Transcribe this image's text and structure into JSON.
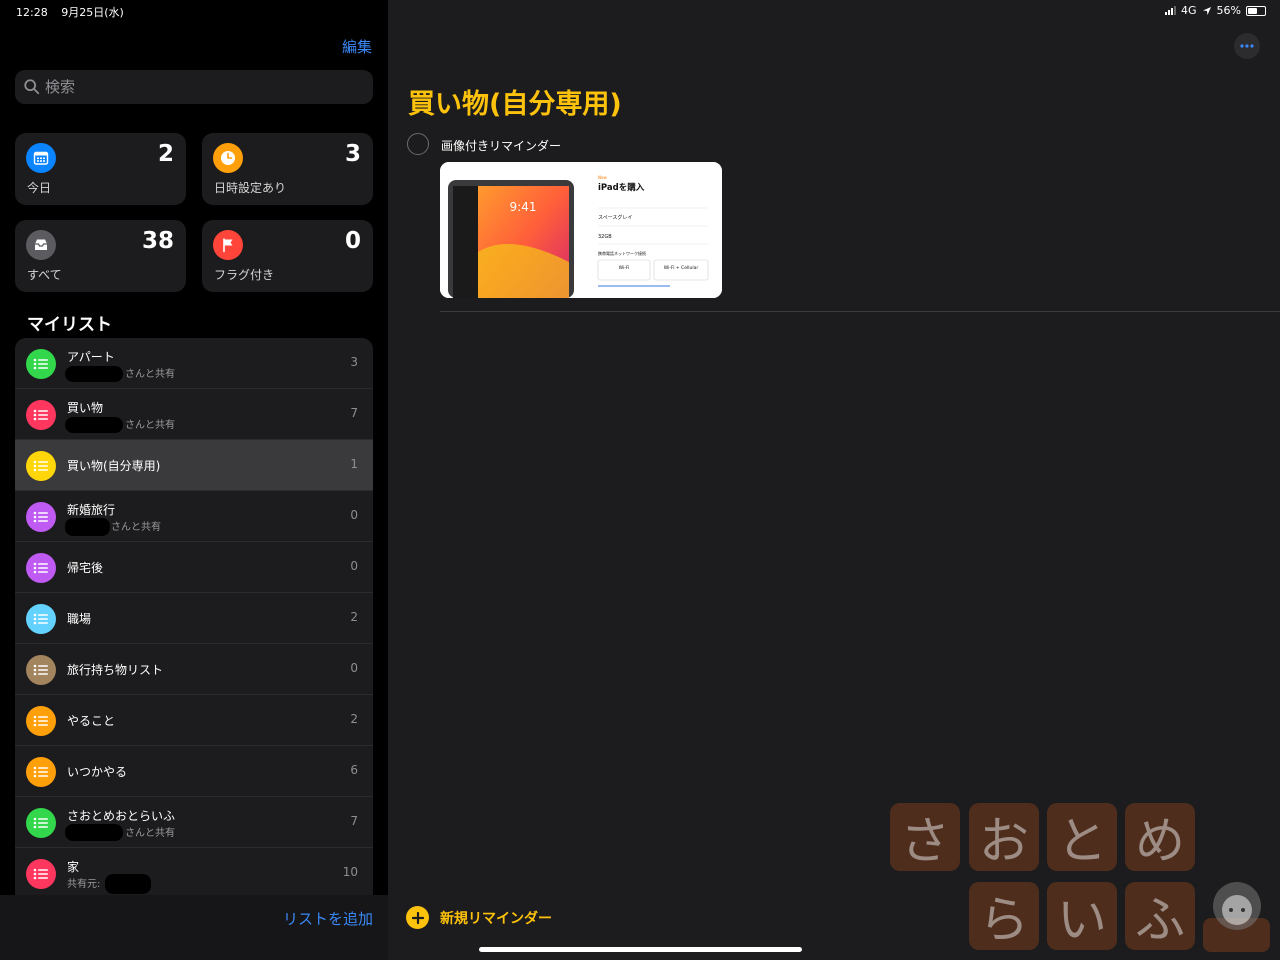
{
  "status": {
    "time": "12:28",
    "date": "9月25日(水)",
    "network": "4G",
    "battery": "56%",
    "battery_level": 0.56
  },
  "sidebar": {
    "edit_label": "編集",
    "search_placeholder": "検索",
    "smart_lists": [
      {
        "label": "今日",
        "count": "2",
        "icon": "calendar-icon",
        "color": "#0a84ff"
      },
      {
        "label": "日時設定あり",
        "count": "3",
        "icon": "clock-icon",
        "color": "#ff9f0a"
      },
      {
        "label": "すべて",
        "count": "38",
        "icon": "tray-icon",
        "color": "#5c5c60"
      },
      {
        "label": "フラグ付き",
        "count": "0",
        "icon": "flag-icon",
        "color": "#ff453a"
      }
    ],
    "my_lists_title": "マイリスト",
    "lists": [
      {
        "name": "アパート",
        "subtitle": "さんと共有",
        "count": "3",
        "color": "#32d74b"
      },
      {
        "name": "買い物",
        "subtitle": "さんと共有",
        "count": "7",
        "color": "#ff375f"
      },
      {
        "name": "買い物(自分専用)",
        "subtitle": "",
        "count": "1",
        "color": "#ffd60a"
      },
      {
        "name": "新婚旅行",
        "subtitle": "さんと共有",
        "count": "0",
        "color": "#bf5af2"
      },
      {
        "name": "帰宅後",
        "subtitle": "",
        "count": "0",
        "color": "#bf5af2"
      },
      {
        "name": "職場",
        "subtitle": "",
        "count": "2",
        "color": "#64d2ff"
      },
      {
        "name": "旅行持ち物リスト",
        "subtitle": "",
        "count": "0",
        "color": "#a2845e"
      },
      {
        "name": "やること",
        "subtitle": "",
        "count": "2",
        "color": "#ff9f0a"
      },
      {
        "name": "いつかやる",
        "subtitle": "",
        "count": "6",
        "color": "#ff9f0a"
      },
      {
        "name": "さおとめおとらいふ",
        "subtitle": "さんと共有",
        "count": "7",
        "color": "#32d74b"
      },
      {
        "name": "家",
        "subtitle": "共有元:",
        "count": "10",
        "color": "#ff375f"
      }
    ],
    "add_list_label": "リストを追加"
  },
  "main": {
    "title": "買い物(自分専用)",
    "title_color": "#fdc20c",
    "reminder": {
      "text": "画像付きリマインダー",
      "attachment": {
        "new_label": "New",
        "heading": "iPadを購入",
        "time_display": "9:41",
        "option1": "スペースグレイ",
        "option2": "32GB",
        "section": "携帯電話ネットワーク接続",
        "choice1": "Wi-Fi",
        "choice2": "Wi-Fi + Cellular"
      }
    },
    "new_reminder_label": "新規リマインダー"
  },
  "watermark": {
    "row1": [
      "さ",
      "お",
      "と",
      "め"
    ],
    "row2": [
      "ら",
      "い",
      "ふ"
    ]
  }
}
